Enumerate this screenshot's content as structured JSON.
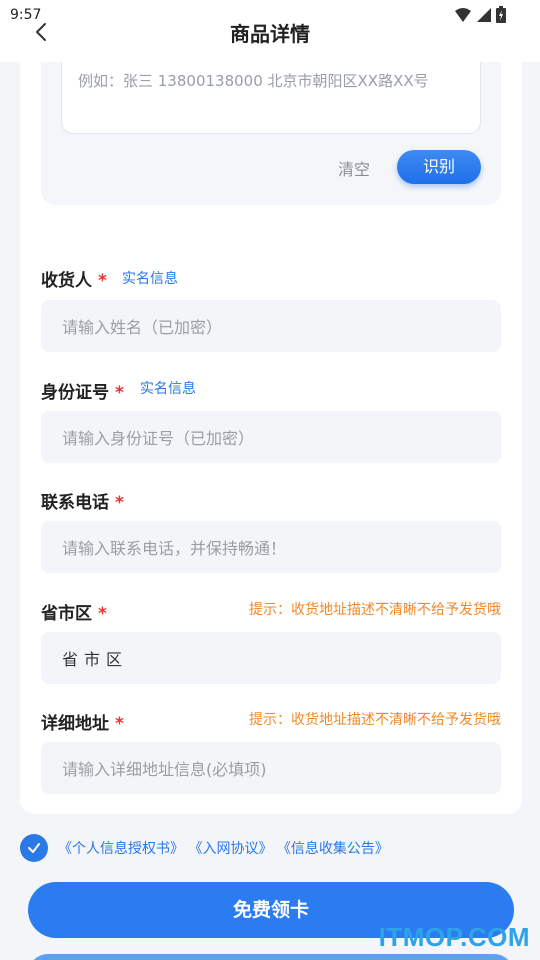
{
  "status_bar": {
    "time": "9:57",
    "icons": [
      "wifi-icon",
      "signal-icon",
      "battery-icon"
    ]
  },
  "header": {
    "title": "商品详情",
    "back_icon": "chevron-left-icon"
  },
  "paste_area": {
    "placeholder": "例如：张三 13800138000 北京市朝阳区XX路XX号",
    "clear_label": "清空",
    "recognize_label": "识别"
  },
  "form": {
    "name": {
      "label": "收货人",
      "required": "*",
      "link": "实名信息",
      "placeholder": "请输入姓名（已加密）"
    },
    "id_card": {
      "label": "身份证号",
      "required": "*",
      "link": "实名信息",
      "placeholder": "请输入身份证号（已加密）"
    },
    "phone": {
      "label": "联系电话",
      "required": "*",
      "placeholder": "请输入联系电话，并保持畅通！"
    },
    "region": {
      "label": "省市区",
      "required": "*",
      "hint": "提示：收货地址描述不清晰不给予发货哦",
      "value": "省市区"
    },
    "address": {
      "label": "详细地址",
      "required": "*",
      "hint": "提示：收货地址描述不清晰不给予发货哦",
      "placeholder": "请输入详细地址信息(必填项)"
    }
  },
  "agreement": {
    "checked": true,
    "links": [
      "《个人信息授权书》",
      "《入网协议》",
      "《信息收集公告》"
    ]
  },
  "submit_label": "免费领卡",
  "watermark": "ITMOP.COM",
  "colors": {
    "primary": "#2a7cf0",
    "required": "#e8332f",
    "hint": "#f08a2a",
    "link": "#2a79e6"
  }
}
